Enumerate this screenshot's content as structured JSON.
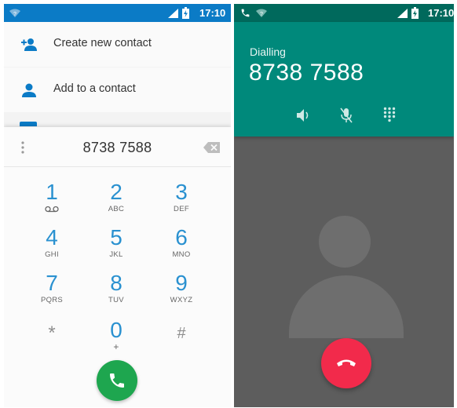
{
  "dialer": {
    "status_time": "17:10",
    "suggestions": [
      {
        "label": "Create new contact",
        "icon": "add-person-icon"
      },
      {
        "label": "Add to a contact",
        "icon": "person-icon"
      }
    ],
    "dialed_number": "8738 7588",
    "keys": [
      {
        "digit": "1",
        "letters": ""
      },
      {
        "digit": "2",
        "letters": "ABC"
      },
      {
        "digit": "3",
        "letters": "DEF"
      },
      {
        "digit": "4",
        "letters": "GHI"
      },
      {
        "digit": "5",
        "letters": "JKL"
      },
      {
        "digit": "6",
        "letters": "MNO"
      },
      {
        "digit": "7",
        "letters": "PQRS"
      },
      {
        "digit": "8",
        "letters": "TUV"
      },
      {
        "digit": "9",
        "letters": "WXYZ"
      },
      {
        "digit": "*",
        "letters": ""
      },
      {
        "digit": "0",
        "letters": "+"
      },
      {
        "digit": "#",
        "letters": ""
      }
    ],
    "colors": {
      "statusbar": "#0b7bc6",
      "digit": "#2a91d0",
      "call_button": "#1ea64f"
    }
  },
  "in_call": {
    "status_time": "17:10",
    "state": "Dialling",
    "number": "8738 7588",
    "controls": [
      "speaker-icon",
      "mute-microphone-icon",
      "dialpad-icon"
    ],
    "colors": {
      "statusbar": "#00695c",
      "header": "#00897b",
      "end_call_button": "#f22a4b"
    }
  }
}
